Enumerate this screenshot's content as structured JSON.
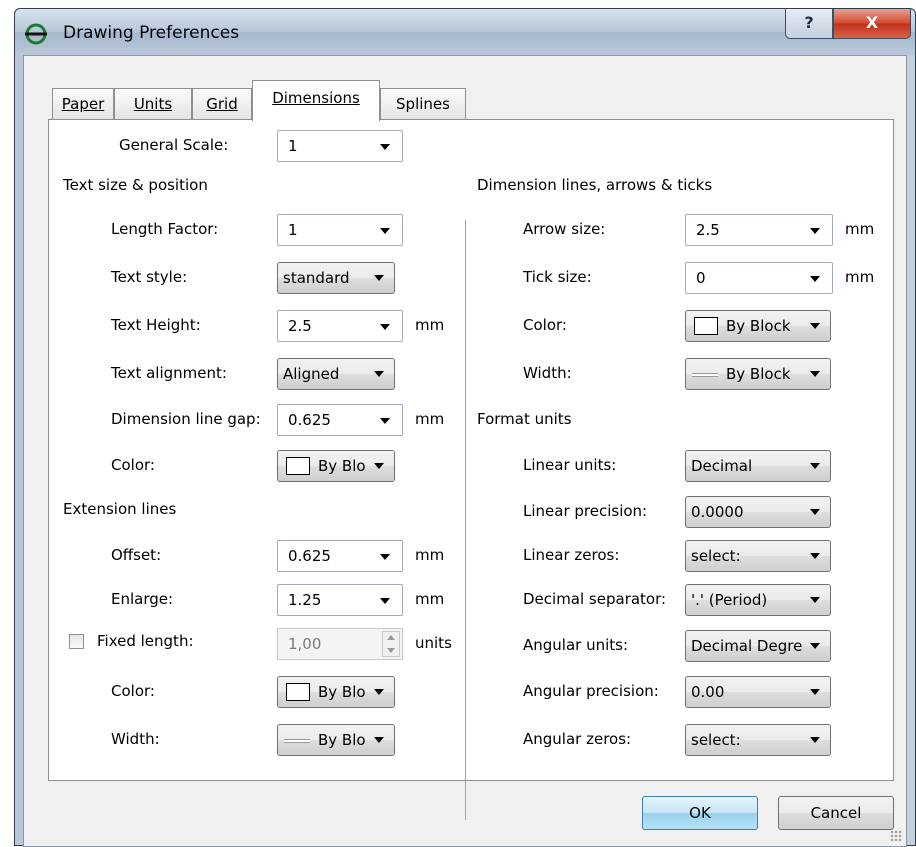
{
  "window": {
    "title": "Drawing Preferences",
    "help_label": "?",
    "close_label": "X"
  },
  "tabs": [
    {
      "label": "Paper"
    },
    {
      "label": "Units"
    },
    {
      "label": "Grid"
    },
    {
      "label": "Dimensions"
    },
    {
      "label": "Splines"
    }
  ],
  "left": {
    "general_scale": {
      "label": "General Scale:",
      "value": "1"
    },
    "text_section": "Text size & position",
    "length_factor": {
      "label": "Length Factor:",
      "value": "1"
    },
    "text_style": {
      "label": "Text style:",
      "value": "standard"
    },
    "text_height": {
      "label": "Text Height:",
      "value": "2.5",
      "unit": "mm"
    },
    "text_alignment": {
      "label": "Text alignment:",
      "value": "Aligned"
    },
    "dim_line_gap": {
      "label": "Dimension line gap:",
      "value": "0.625",
      "unit": "mm"
    },
    "color": {
      "label": "Color:",
      "value": "By Bloc"
    },
    "ext_section": "Extension lines",
    "offset": {
      "label": "Offset:",
      "value": "0.625",
      "unit": "mm"
    },
    "enlarge": {
      "label": "Enlarge:",
      "value": "1.25",
      "unit": "mm"
    },
    "fixed_length": {
      "label": "Fixed length:",
      "value": "1,00",
      "unit": "units",
      "checked": false
    },
    "ext_color": {
      "label": "Color:",
      "value": "By Bloc"
    },
    "ext_width": {
      "label": "Width:",
      "value": "By Bloc"
    }
  },
  "right": {
    "dim_section": "Dimension lines, arrows & ticks",
    "arrow_size": {
      "label": "Arrow size:",
      "value": "2.5",
      "unit": "mm"
    },
    "tick_size": {
      "label": "Tick size:",
      "value": "0",
      "unit": "mm"
    },
    "color": {
      "label": "Color:",
      "value": "By Block"
    },
    "width": {
      "label": "Width:",
      "value": "By Block"
    },
    "format_section": "Format units",
    "linear_units": {
      "label": "Linear units:",
      "value": "Decimal"
    },
    "linear_precision": {
      "label": "Linear precision:",
      "value": "0.0000"
    },
    "linear_zeros": {
      "label": "Linear zeros:",
      "value": "select:"
    },
    "decimal_separator": {
      "label": "Decimal separator:",
      "value": "'.' (Period)"
    },
    "angular_units": {
      "label": "Angular units:",
      "value": "Decimal Degre"
    },
    "angular_precision": {
      "label": "Angular precision:",
      "value": "0.00"
    },
    "angular_zeros": {
      "label": "Angular zeros:",
      "value": "select:"
    }
  },
  "buttons": {
    "ok": "OK",
    "cancel": "Cancel"
  }
}
